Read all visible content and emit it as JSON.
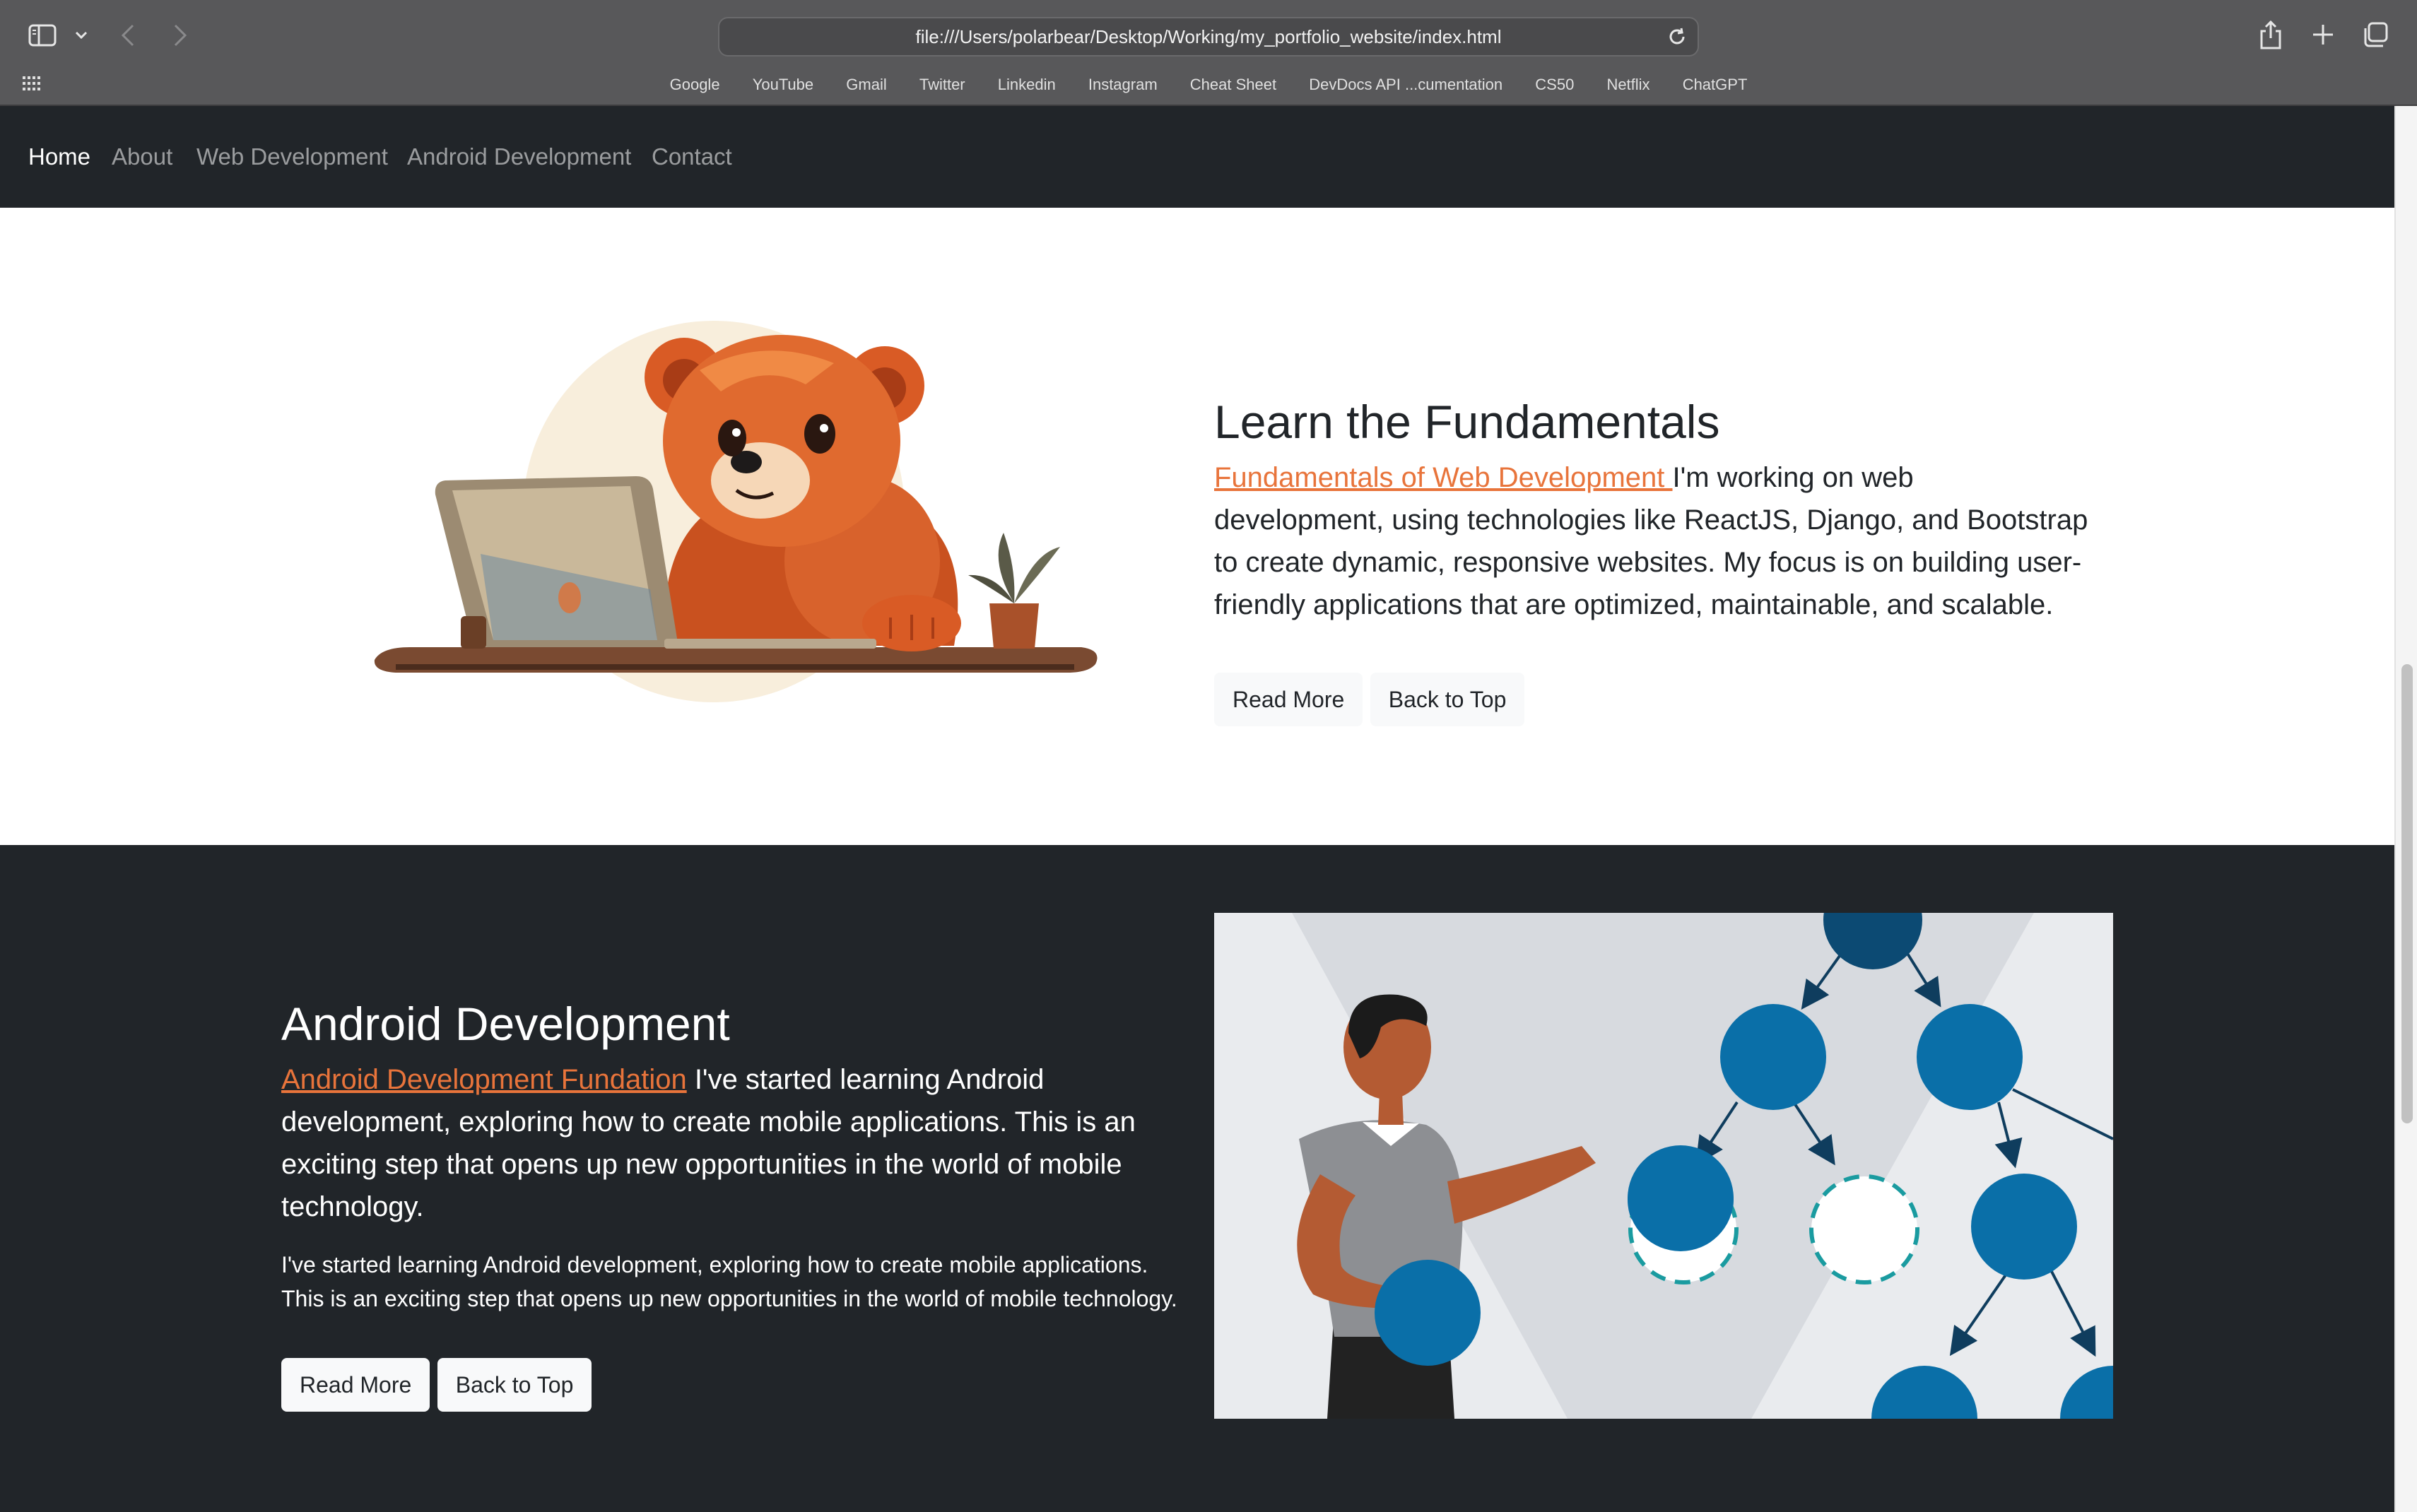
{
  "browser": {
    "url": "file:///Users/polarbear/Desktop/Working/my_portfolio_website/index.html",
    "bookmarks": [
      "Google",
      "YouTube",
      "Gmail",
      "Twitter",
      "Linkedin",
      "Instagram",
      "Cheat Sheet",
      "DevDocs API ...cumentation",
      "CS50",
      "Netflix",
      "ChatGPT"
    ]
  },
  "nav": {
    "items": [
      "Home",
      "About",
      "Web Development",
      "Android Development",
      "Contact"
    ],
    "active": "Home"
  },
  "section_fundamentals": {
    "title": "Learn the Fundamentals",
    "link": "Fundamentals of Web Development ",
    "body": "I'm working on web development, using technologies like ReactJS, Django, and Bootstrap to create dynamic, responsive websites. My focus is on building user-friendly applications that are optimized, maintainable, and scalable.",
    "read_more": "Read More",
    "back_to_top": "Back to Top"
  },
  "section_android": {
    "title": "Android Development",
    "link": "Android Development Fundation",
    "lead": " I've started learning Android development, exploring how to create mobile applications. This is an exciting step that opens up new opportunities in the world of mobile technology.",
    "body": "I've started learning Android development, exploring how to create mobile applications. This is an exciting step that opens up new opportunities in the world of mobile technology.",
    "read_more": "Read More",
    "back_to_top": "Back to Top"
  },
  "colors": {
    "accent_link": "#e8743b",
    "dark_bg": "#212529",
    "light_btn": "#f8f9fa",
    "node_blue": "#0a6fa8"
  },
  "icons": [
    "sidebar-icon",
    "chevron-down-icon",
    "back-arrow-icon",
    "forward-arrow-icon",
    "reload-icon",
    "share-icon",
    "new-tab-icon",
    "tabs-overview-icon",
    "grid-icon"
  ]
}
